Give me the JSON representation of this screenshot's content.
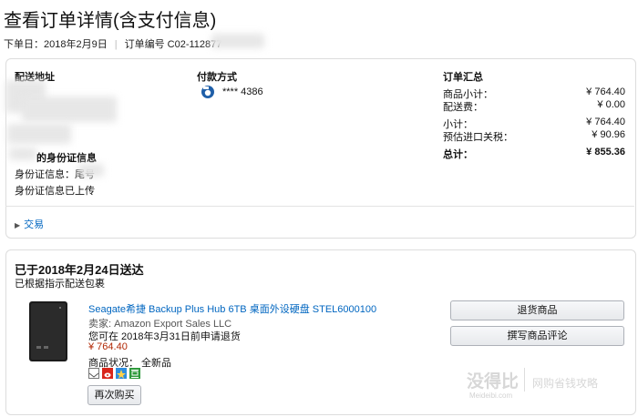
{
  "header": {
    "title": "查看订单详情(含支付信息)",
    "order_date": "下单日：2018年2月9日",
    "order_number": "订单编号 C02-112877"
  },
  "shipping": {
    "heading": "配送地址",
    "id_heading": "的身份证信息",
    "id_info": "身份证信息：尾号",
    "id_uploaded": "身份证信息已上传"
  },
  "payment": {
    "heading": "付款方式",
    "card": "**** 4386"
  },
  "summary": {
    "heading": "订单汇总",
    "rows": [
      {
        "label": "商品小计：",
        "value": "¥ 764.40"
      },
      {
        "label": "配送费：",
        "value": "¥ 0.00"
      },
      {
        "label": "小计：",
        "value": "¥ 764.40"
      },
      {
        "label": "预估进口关税：",
        "value": "¥ 90.96"
      },
      {
        "label": "总计：",
        "value": "¥ 855.36"
      }
    ]
  },
  "transaction_link": "交易",
  "shipment": {
    "delivered": "已于2018年2月24日送达",
    "note": "已根据指示配送包裹"
  },
  "product": {
    "name": "Seagate希捷 Backup Plus Hub 6TB 桌面外设硬盘 STEL6000100",
    "seller": "卖家: Amazon Export Sales LLC",
    "return_window": "您可在 2018年3月31日前申请退货",
    "price": "¥ 764.40",
    "condition": "商品状况： 全新品",
    "buy_again": "再次购买"
  },
  "actions": {
    "return": "退货商品",
    "review": "撰写商品评论"
  },
  "watermark": {
    "brand": "没得比",
    "url": "Meideibi.com",
    "slogan": "网购省钱攻略"
  }
}
